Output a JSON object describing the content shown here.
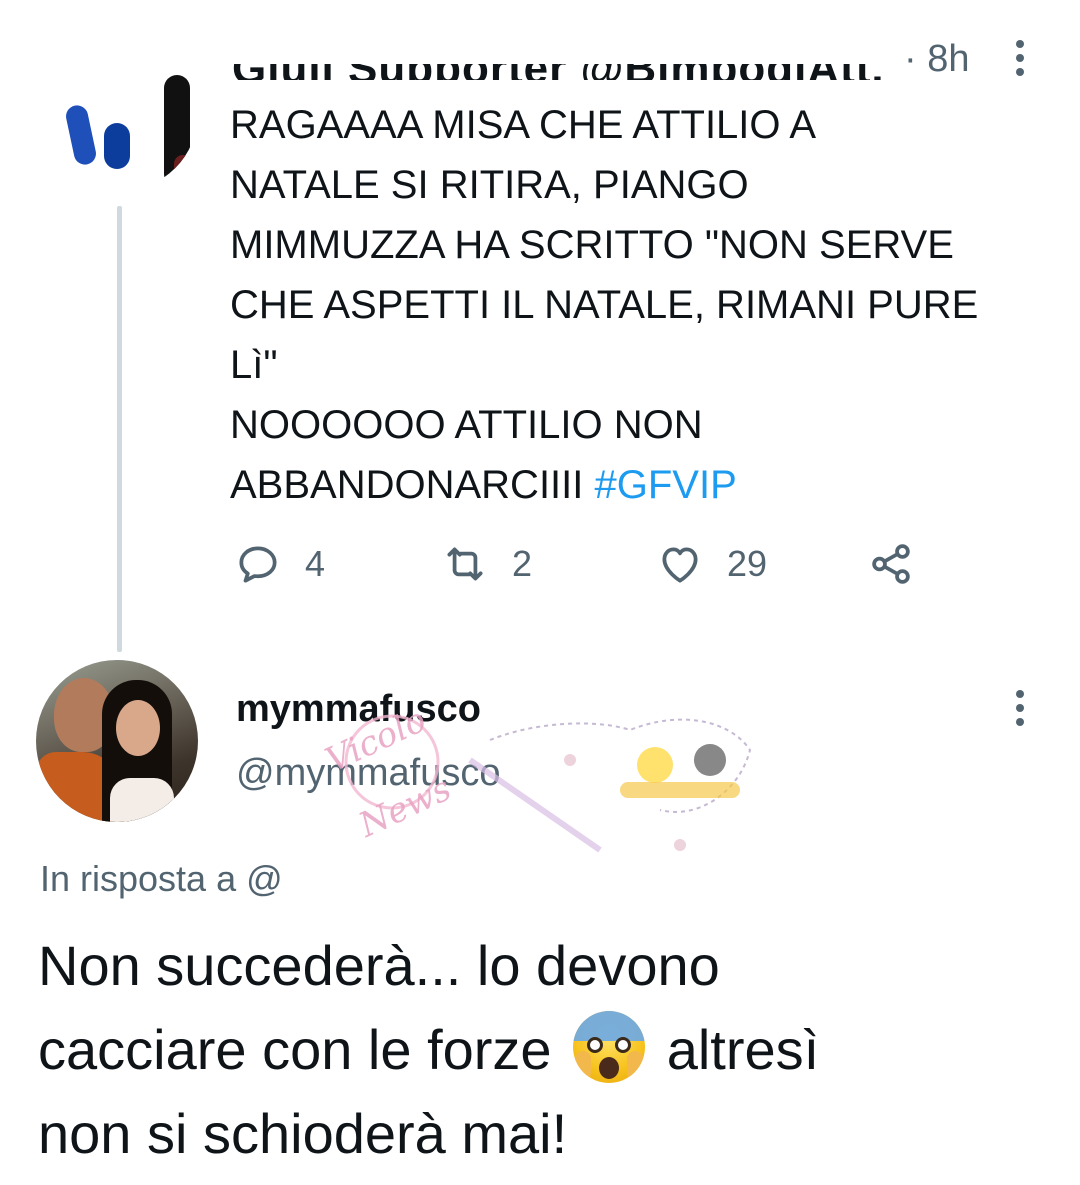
{
  "parent_tweet": {
    "author_obscured": "Giuli Supporter @BimbodiAtt...",
    "time": "· 8h",
    "text": "RAGAAAA MISA CHE ATTILIO A\nNATALE SI RITIRA, PIANGO\nMIMMUZZA HA SCRITTO \"NON SERVE\nCHE ASPETTI IL NATALE, RIMANI PURE\nLì\"\nNOOOOOO ATTILIO NON\nABBANDONARCIIII ",
    "hashtag": "#GFVIP",
    "replies": "4",
    "retweets": "2",
    "likes": "29"
  },
  "reply": {
    "display_name": "mymmafusco",
    "handle": "@mymmafusco",
    "in_reply_to_label": "In risposta a @",
    "text_line1": "Non succederà... lo devono",
    "text_line2_before": "cacciare con le forze",
    "text_line2_after": "altresì",
    "text_line3": "non si schioderà mai!"
  },
  "icons": {
    "reply": "comment-icon",
    "retweet": "retweet-icon",
    "like": "heart-icon",
    "share": "share-icon",
    "more": "more-vertical-icon",
    "emoji": "face-screaming-in-fear-emoji"
  },
  "colors": {
    "text": "#0f1419",
    "secondary": "#536471",
    "link": "#1d9bf0",
    "thread_line": "#cfd9de"
  }
}
